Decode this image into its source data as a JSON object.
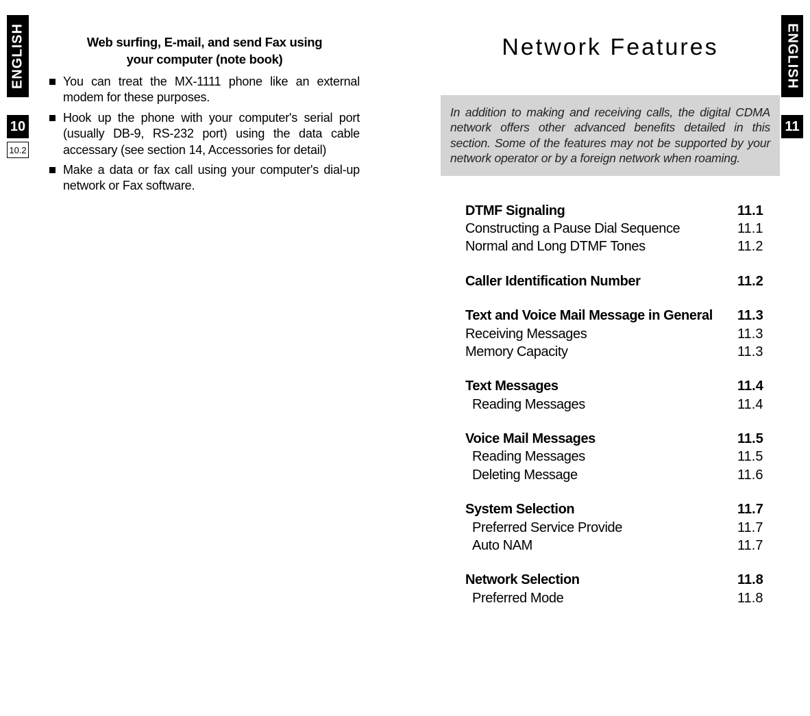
{
  "left": {
    "lang_tab": "ENGLISH",
    "page_tab": "10",
    "sub_tab": "10.2",
    "heading_line1": "Web surfing, E-mail, and send Fax using",
    "heading_line2": "your computer (note book)",
    "bullets": [
      "You can treat the MX-1111 phone like an external modem for these purposes.",
      "Hook up the phone with your computer's serial port (usually DB-9, RS-232 port) using the data cable accessary (see section 14, Accessories for detail)",
      "Make a data or fax call using your computer's dial-up network or Fax software."
    ]
  },
  "right": {
    "lang_tab": "ENGLISH",
    "page_tab": "11",
    "chapter_title": "Network Features",
    "intro": "In addition to making and receiving calls, the digital CDMA network offers other advanced benefits detailed in this section. Some of the features may not be supported by your network operator or by a foreign network when roaming.",
    "toc": [
      {
        "label": "DTMF Signaling",
        "num": "11.1",
        "bold": true,
        "indent": false
      },
      {
        "label": "Constructing a Pause Dial Sequence",
        "num": "11.1",
        "bold": false,
        "indent": false
      },
      {
        "label": "Normal and Long DTMF Tones",
        "num": "11.2",
        "bold": false,
        "indent": false
      },
      {
        "label": "Caller Identification Number",
        "num": "11.2",
        "bold": true,
        "indent": false
      },
      {
        "label": "Text and Voice Mail Message in General",
        "num": "11.3",
        "bold": true,
        "indent": false
      },
      {
        "label": "Receiving Messages",
        "num": "11.3",
        "bold": false,
        "indent": false
      },
      {
        "label": "Memory Capacity",
        "num": "11.3",
        "bold": false,
        "indent": false
      },
      {
        "label": "Text Messages",
        "num": "11.4",
        "bold": true,
        "indent": false
      },
      {
        "label": "Reading Messages",
        "num": "11.4",
        "bold": false,
        "indent": true
      },
      {
        "label": "Voice Mail Messages",
        "num": "11.5",
        "bold": true,
        "indent": false
      },
      {
        "label": "Reading Messages",
        "num": "11.5",
        "bold": false,
        "indent": true
      },
      {
        "label": "Deleting Message",
        "num": "11.6",
        "bold": false,
        "indent": true
      },
      {
        "label": "System Selection",
        "num": "11.7",
        "bold": true,
        "indent": false
      },
      {
        "label": "Preferred Service Provide",
        "num": "11.7",
        "bold": false,
        "indent": true
      },
      {
        "label": "Auto NAM",
        "num": "11.7",
        "bold": false,
        "indent": true
      },
      {
        "label": "Network Selection",
        "num": "11.8",
        "bold": true,
        "indent": false
      },
      {
        "label": "Preferred Mode",
        "num": "11.8",
        "bold": false,
        "indent": true
      }
    ]
  }
}
